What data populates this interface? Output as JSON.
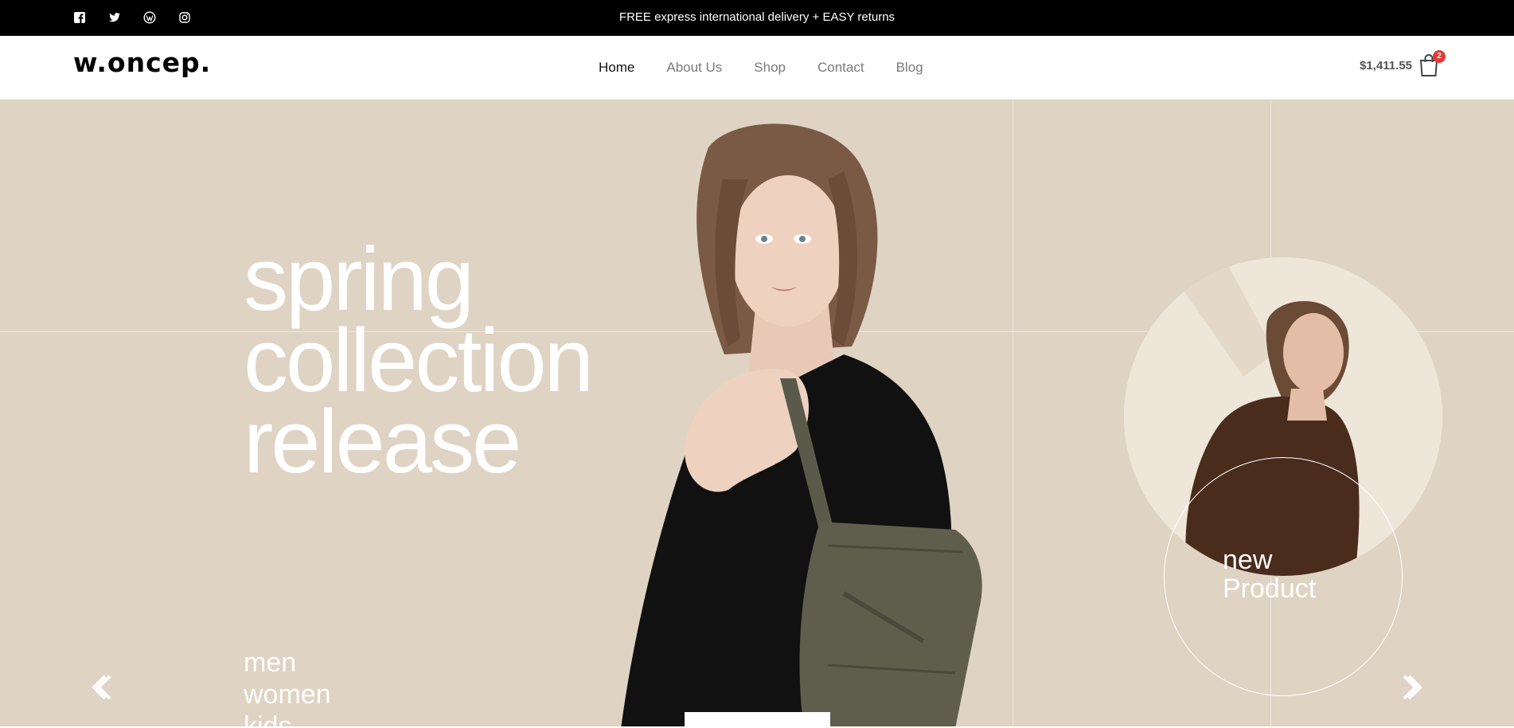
{
  "topbar": {
    "socials": [
      {
        "icon": "facebook-icon"
      },
      {
        "icon": "twitter-icon"
      },
      {
        "icon": "wordpress-icon"
      },
      {
        "icon": "instagram-icon"
      }
    ],
    "promo_text": "FREE express international delivery + EASY returns"
  },
  "header": {
    "logo": "w.oncep.",
    "nav": [
      "Home",
      "About Us",
      "Shop",
      "Contact",
      "Blog"
    ],
    "active_nav": "Home",
    "cart_total": "$1,411.55",
    "cart_count": "2"
  },
  "hero": {
    "headline": [
      "spring",
      "collection",
      "release"
    ],
    "categories": [
      "men",
      "women",
      "kids"
    ],
    "new_product": [
      "new",
      "Product"
    ],
    "background_color": "#dfd3c3"
  },
  "colors": {
    "topbar_bg": "#000000",
    "hero_bg": "#dfd3c3",
    "badge": "#e53935",
    "nav_active": "#111111",
    "nav_inactive": "#7a7a7a"
  }
}
